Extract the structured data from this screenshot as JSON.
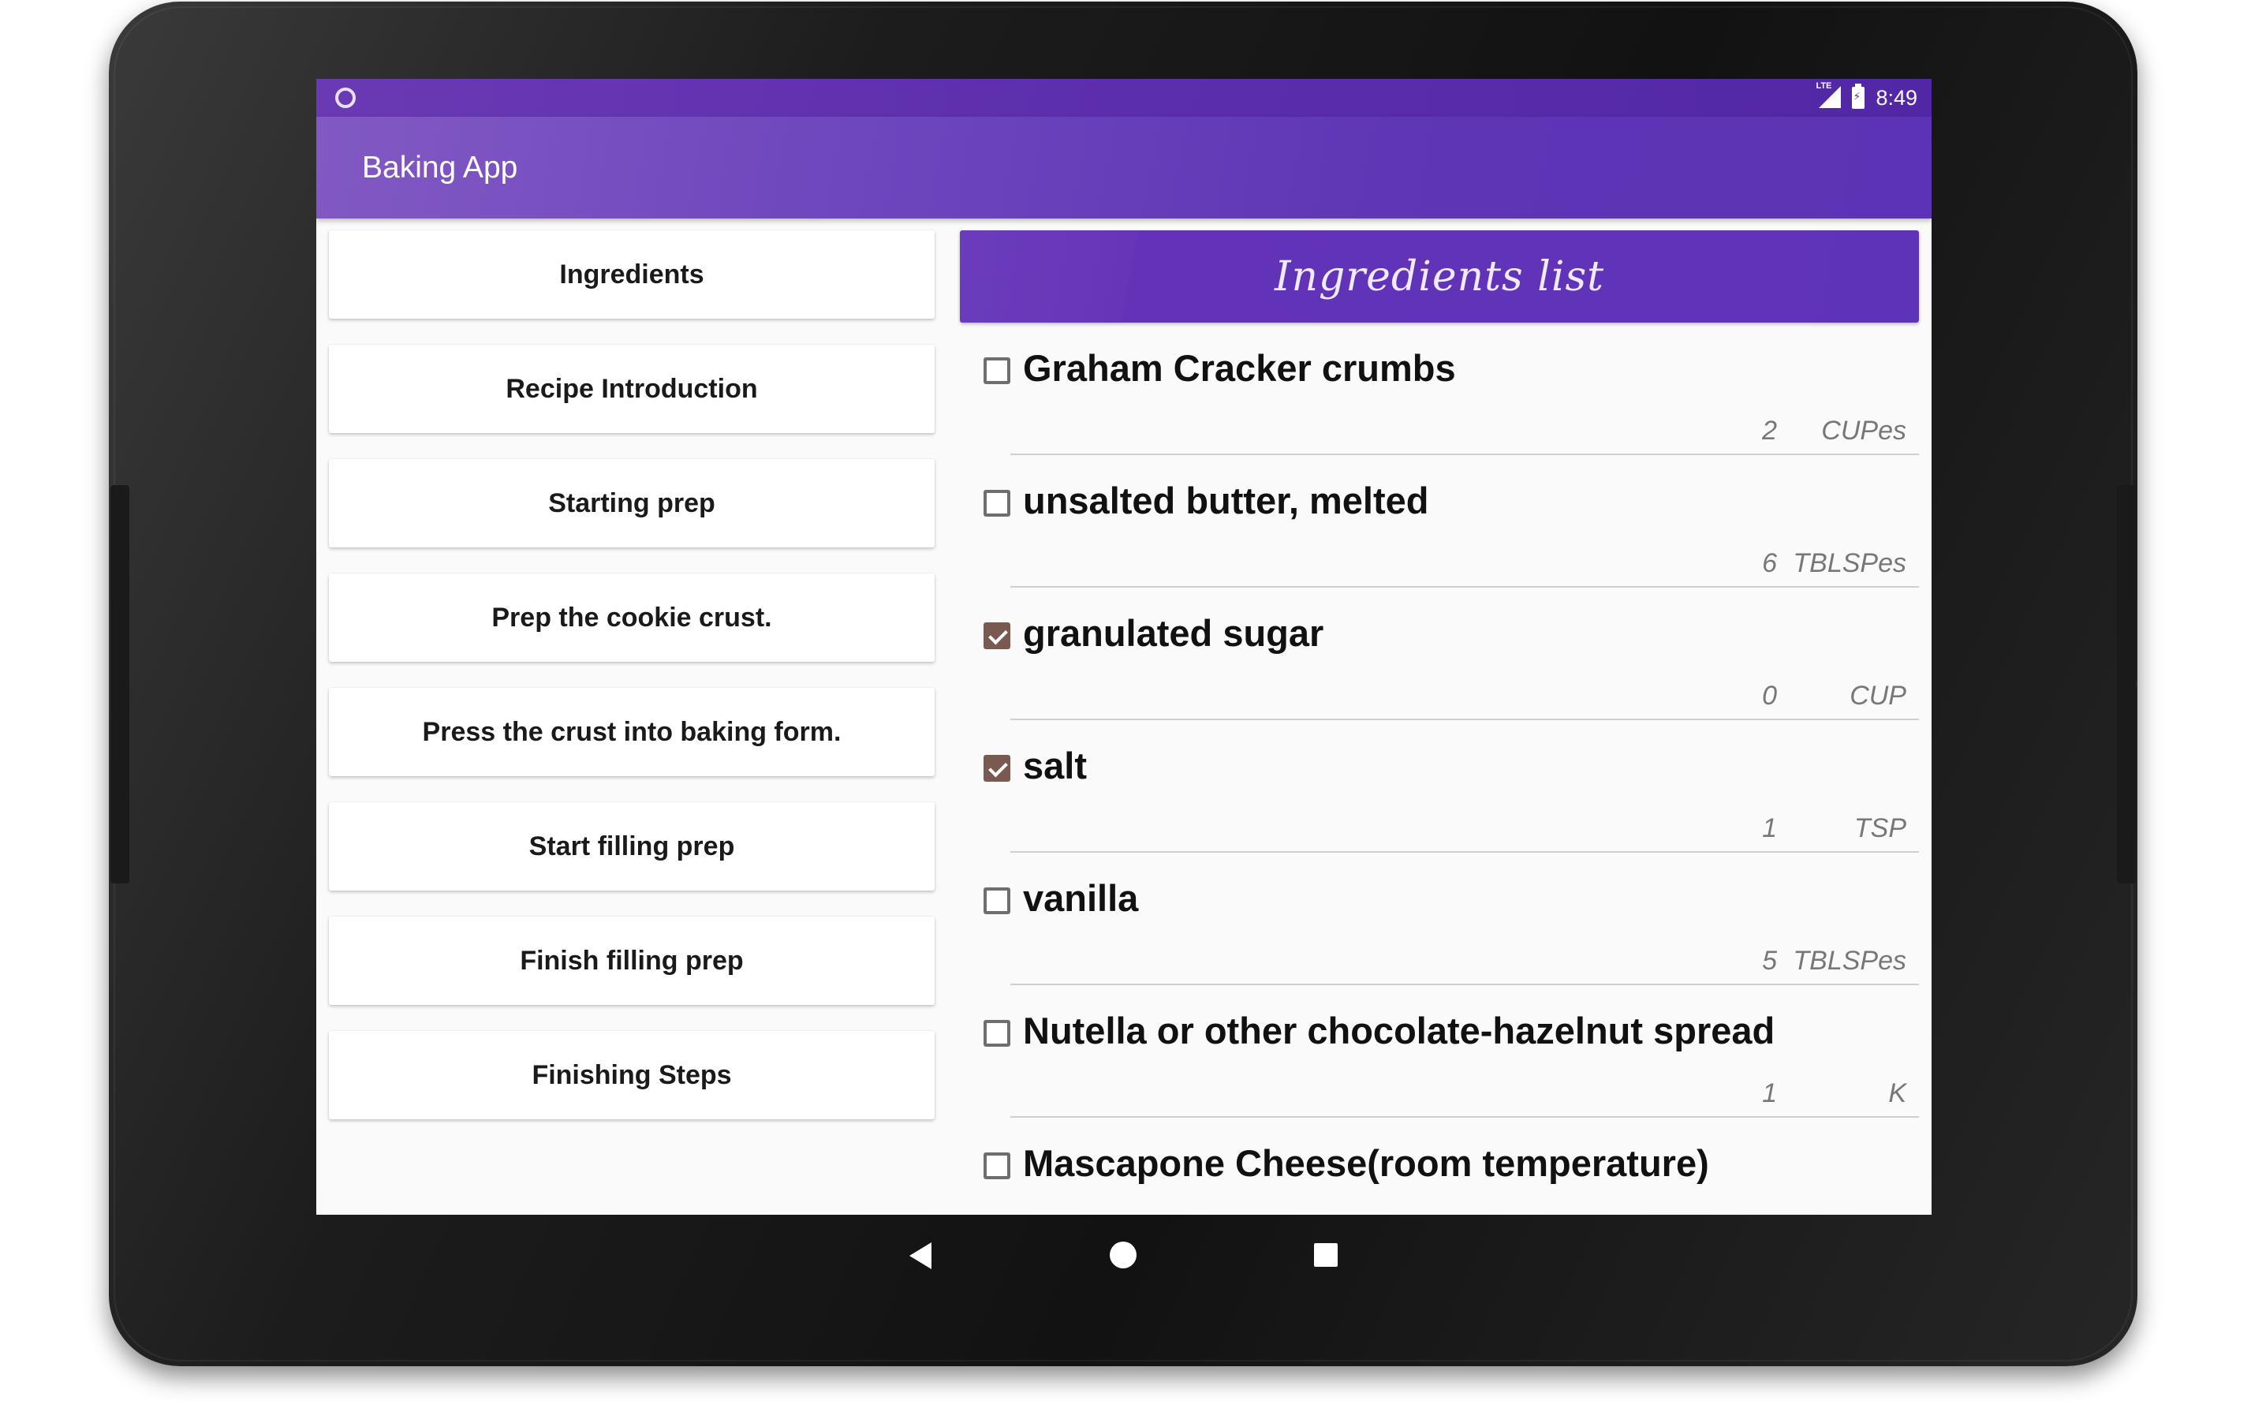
{
  "status_bar": {
    "time": "8:49",
    "network": "LTE"
  },
  "app_bar": {
    "title": "Baking App"
  },
  "steps": [
    "Ingredients",
    "Recipe Introduction",
    "Starting prep",
    "Prep the cookie crust.",
    "Press the crust into baking form.",
    "Start filling prep",
    "Finish filling prep",
    "Finishing Steps"
  ],
  "ingredients_panel": {
    "header": "Ingredients list",
    "items": [
      {
        "name": "Graham Cracker crumbs",
        "quantity": "2",
        "measure": "CUPes",
        "checked": false
      },
      {
        "name": "unsalted butter, melted",
        "quantity": "6",
        "measure": "TBLSPes",
        "checked": false
      },
      {
        "name": "granulated sugar",
        "quantity": "0",
        "measure": "CUP",
        "checked": true
      },
      {
        "name": "salt",
        "quantity": "1",
        "measure": "TSP",
        "checked": true
      },
      {
        "name": "vanilla",
        "quantity": "5",
        "measure": "TBLSPes",
        "checked": false
      },
      {
        "name": "Nutella or other chocolate-hazelnut spread",
        "quantity": "1",
        "measure": "K",
        "checked": false
      },
      {
        "name": "Mascapone Cheese(room temperature)",
        "quantity": "",
        "measure": "",
        "checked": false
      }
    ]
  },
  "colors": {
    "primary": "#5b33b4",
    "primary_light": "#8259c3",
    "checkbox_checked": "#7a5a50"
  },
  "nav_icons": [
    "back-icon",
    "home-icon",
    "recents-icon"
  ]
}
